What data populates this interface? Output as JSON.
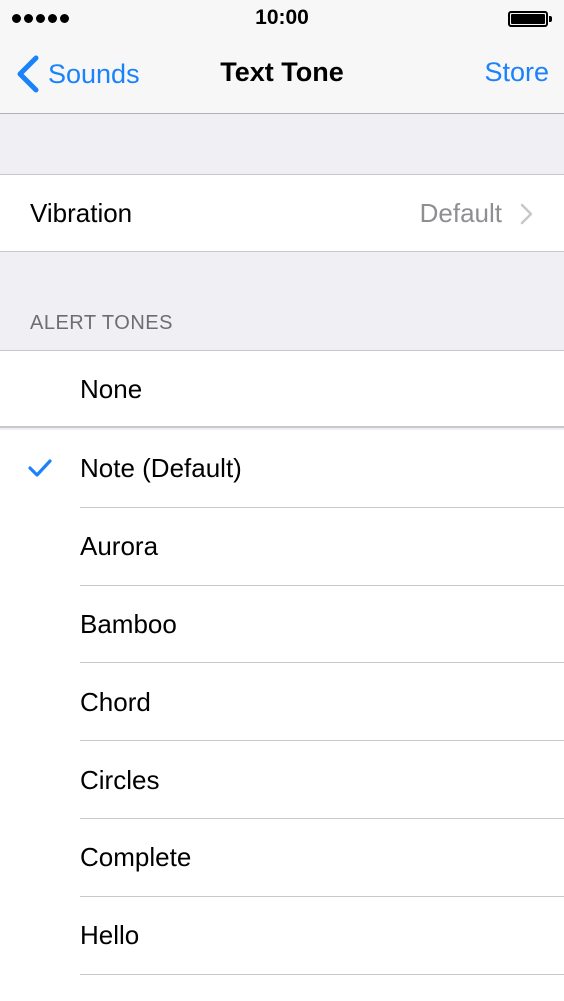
{
  "status_bar": {
    "time": "10:00",
    "signal_dots": 5,
    "battery_level": 1.0
  },
  "nav": {
    "back_label": "Sounds",
    "title": "Text Tone",
    "right_label": "Store"
  },
  "vibration": {
    "label": "Vibration",
    "value": "Default"
  },
  "alert_tones": {
    "header": "ALERT TONES",
    "none_label": "None",
    "selected": "Note (Default)",
    "items": [
      "Note (Default)",
      "Aurora",
      "Bamboo",
      "Chord",
      "Circles",
      "Complete",
      "Hello"
    ]
  },
  "colors": {
    "accent": "#1a82fb",
    "background": "#efeff4",
    "separator": "#c8c7cc",
    "secondary_text": "#8e8e93"
  }
}
